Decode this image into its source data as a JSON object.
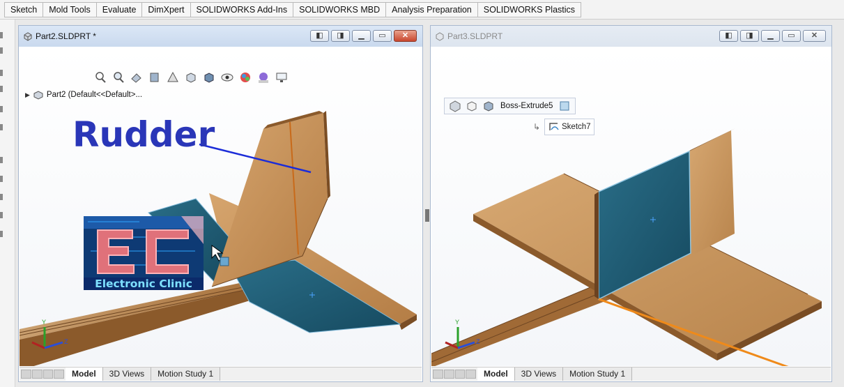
{
  "tabs": [
    "Sketch",
    "Mold Tools",
    "Evaluate",
    "DimXpert",
    "SOLIDWORKS Add-Ins",
    "SOLIDWORKS MBD",
    "Analysis Preparation",
    "SOLIDWORKS Plastics"
  ],
  "window1": {
    "title": "Part2.SLDPRT *",
    "tree_label": "Part2  (Default<<Default>...",
    "annotation": "Rudder",
    "logo_text": "Electronic Clinic",
    "bottom_tabs": [
      "Model",
      "3D Views",
      "Motion Study 1"
    ]
  },
  "window2": {
    "title": "Part3.SLDPRT",
    "breadcrumb_feature": "Boss-Extrude5",
    "sketch_label": "Sketch7",
    "bottom_tabs": [
      "Model",
      "3D Views",
      "Motion Study 1"
    ]
  },
  "colors": {
    "wood": "#c9955e",
    "selected_face": "#1f5a72",
    "annotation": "#2a36b8",
    "sketch_line": "#ef8a1a"
  }
}
